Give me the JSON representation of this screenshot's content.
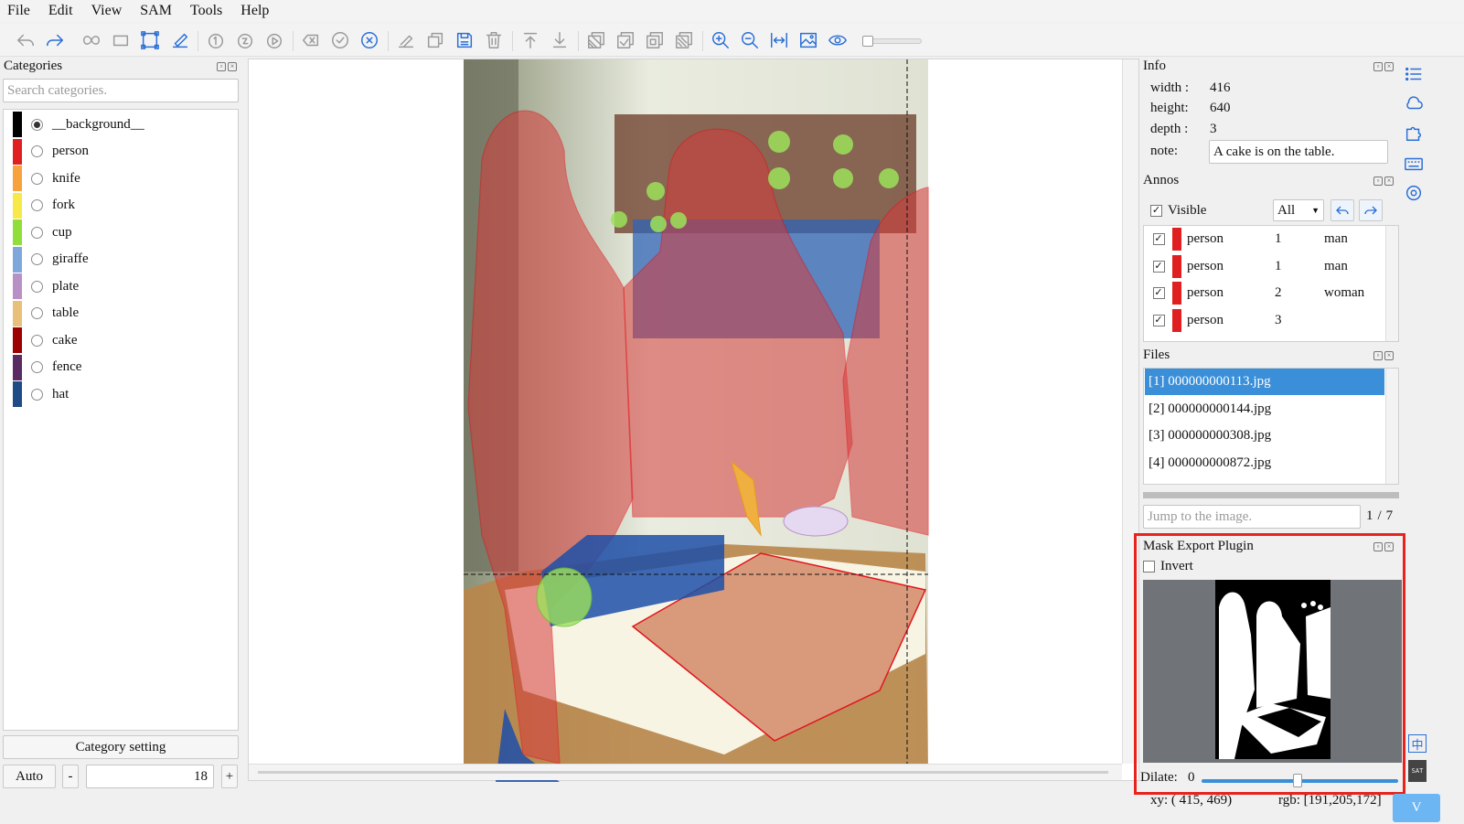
{
  "menu": [
    "File",
    "Edit",
    "View",
    "SAM",
    "Tools",
    "Help"
  ],
  "toolbar": {
    "icons": [
      "undo-icon",
      "redo-icon",
      "polygon-tool-icon",
      "rectangle-tool-icon",
      "edit-shape-icon",
      "brush-icon",
      "sam-point-icon",
      "sam-box-icon",
      "sam-run-icon",
      "clear-icon",
      "finish-icon",
      "cancel-icon",
      "edit-label-icon",
      "copy-icon",
      "save-icon",
      "delete-icon",
      "move-top-icon",
      "move-bottom-icon",
      "hide-masks-icon",
      "show-masks-icon",
      "mask-toggle-icon",
      "all-masks-icon",
      "zoom-in-icon",
      "zoom-out-icon",
      "fit-width-icon",
      "image-icon",
      "preview-icon"
    ],
    "zoom_slider": 0
  },
  "categories": {
    "title": "Categories",
    "search_placeholder": "Search categories.",
    "items": [
      {
        "name": "__background__",
        "color": "#000000",
        "selected": true
      },
      {
        "name": "person",
        "color": "#e02020",
        "selected": false
      },
      {
        "name": "knife",
        "color": "#f7a23c",
        "selected": false
      },
      {
        "name": "fork",
        "color": "#f7e94a",
        "selected": false
      },
      {
        "name": "cup",
        "color": "#8fde3a",
        "selected": false
      },
      {
        "name": "giraffe",
        "color": "#7ea7dc",
        "selected": false
      },
      {
        "name": "plate",
        "color": "#b990c6",
        "selected": false
      },
      {
        "name": "table",
        "color": "#e8c07a",
        "selected": false
      },
      {
        "name": "cake",
        "color": "#9c0000",
        "selected": false
      },
      {
        "name": "fence",
        "color": "#5a2a62",
        "selected": false
      },
      {
        "name": "hat",
        "color": "#1f4b86",
        "selected": false
      }
    ],
    "setting_button": "Category setting",
    "auto_button": "Auto",
    "minus_button": "-",
    "plus_button": "+",
    "brush_size": "18"
  },
  "info": {
    "title": "Info",
    "width_label": "width :",
    "width": "416",
    "height_label": "height:",
    "height": "640",
    "depth_label": "depth :",
    "depth": "3",
    "note_label": "note:",
    "note": "A cake is on the table."
  },
  "annos": {
    "title": "Annos",
    "visible_label": "Visible",
    "filter": "All",
    "rows": [
      {
        "category": "person",
        "group": "1",
        "note": "man",
        "checked": true,
        "color": "#e02020"
      },
      {
        "category": "person",
        "group": "1",
        "note": "man",
        "checked": true,
        "color": "#e02020"
      },
      {
        "category": "person",
        "group": "2",
        "note": "woman",
        "checked": true,
        "color": "#e02020"
      },
      {
        "category": "person",
        "group": "3",
        "note": "",
        "checked": true,
        "color": "#e02020"
      }
    ]
  },
  "files": {
    "title": "Files",
    "items": [
      "[1] 000000000113.jpg",
      "[2] 000000000144.jpg",
      "[3] 000000000308.jpg",
      "[4] 000000000872.jpg"
    ],
    "selected_index": 0,
    "jump_placeholder": "Jump to the image.",
    "page": "1",
    "page_sep": "/",
    "total": "7"
  },
  "mask_export": {
    "title": "Mask Export Plugin",
    "invert_label": "Invert",
    "dilate_label": "Dilate:",
    "dilate_value": "0"
  },
  "status": {
    "xy": "xy: ( 415, 469)",
    "rgb": "rgb: [191,205,172]"
  },
  "sidebar_right": [
    "list-icon",
    "cloud-icon",
    "plugin-icon",
    "keyboard-icon",
    "settings-icon"
  ],
  "lang_badge": "中",
  "sat_badge": "SAT",
  "blue_btn": "V",
  "colors": {
    "accent": "#2a6fd6",
    "selection": "#3a8fd8",
    "highlight": "#e8231d"
  }
}
